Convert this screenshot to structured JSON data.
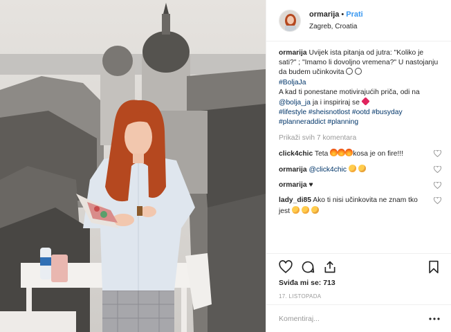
{
  "post": {
    "username": "ormarija",
    "follow_label": "Prati",
    "location": "Zagreb, Croatia",
    "caption_parts": {
      "text1": "Uvijek ista pitanja od jutra: \"Koliko je sati?\" ; \"Imamo li dovoljno vremena?\" U nastojanju da budem učinkovita",
      "hashtag1": "#BoljaJa",
      "text2": "A kad ti ponestane motivirajućih priča, odi na",
      "mention": "@bolja_ja",
      "text3": "ja i inspiriraj se",
      "hashtags": "#lifestyle #sheisnotlost #ootd #busyday #planneraddict #planning"
    },
    "view_all_label": "Prikaži svih 7 komentara",
    "comments": [
      {
        "user": "click4chic",
        "text_before": "Teta",
        "text_after": "kosa je on fire!!!"
      },
      {
        "user": "ormarija",
        "mention": "@click4chic"
      },
      {
        "user": "ormarija",
        "text": "♥"
      },
      {
        "user": "lady_di85",
        "text": "Ako ti nisi učinkovita ne znam tko jest"
      }
    ],
    "likes_label": "Sviđa mi se: 713",
    "date_label": "17. LISTOPADA",
    "add_comment_placeholder": "Komentiraj..."
  },
  "icons": [
    "heart-icon",
    "comment-icon",
    "share-icon",
    "bookmark-icon",
    "more-icon"
  ],
  "colors": {
    "accent": "#3897f0",
    "link": "#003569",
    "muted": "#999999"
  }
}
